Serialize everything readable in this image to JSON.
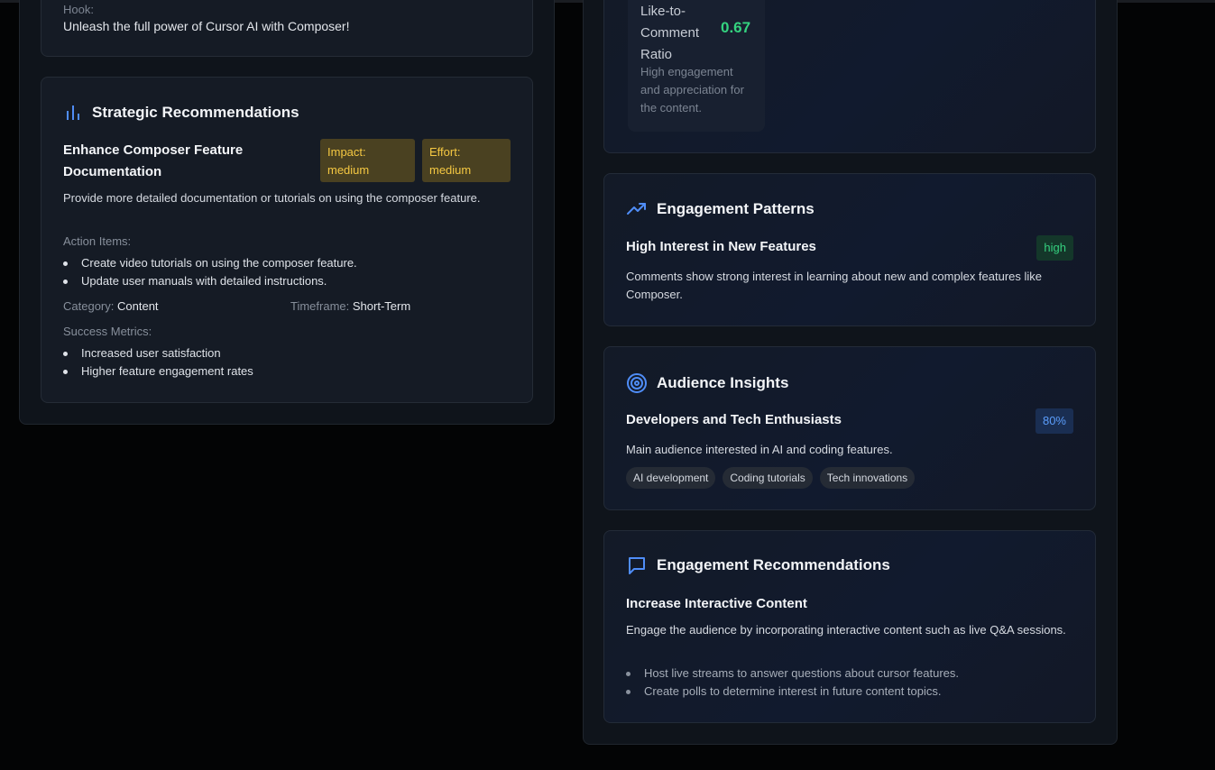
{
  "hook": {
    "label": "Hook:",
    "text": "Unleash the full power of Cursor AI with Composer!"
  },
  "strategic": {
    "title": "Strategic Recommendations",
    "rec_title": "Enhance Composer Feature Documentation",
    "impact": "Impact: medium",
    "effort": "Effort: medium",
    "description": "Provide more detailed documentation or tutorials on using the composer feature.",
    "action_items_label": "Action Items:",
    "action_items": [
      "Create video tutorials on using the composer feature.",
      "Update user manuals with detailed instructions."
    ],
    "category_label": "Category:",
    "category": "Content",
    "timeframe_label": "Timeframe:",
    "timeframe": "Short-Term",
    "success_label": "Success Metrics:",
    "success_metrics": [
      "Increased user satisfaction",
      "Higher feature engagement rates"
    ]
  },
  "metric": {
    "label": "Like-to-Comment Ratio",
    "value": "0.67",
    "description": "High engagement and appreciation for the content."
  },
  "patterns": {
    "title": "Engagement Patterns",
    "item_title": "High Interest in New Features",
    "level": "high",
    "description": "Comments show strong interest in learning about new and complex features like Composer."
  },
  "audience": {
    "title": "Audience Insights",
    "item_title": "Developers and Tech Enthusiasts",
    "percent": "80%",
    "description": "Main audience interested in AI and coding features.",
    "tags": [
      "AI development",
      "Coding tutorials",
      "Tech innovations"
    ]
  },
  "engagement_recs": {
    "title": "Engagement Recommendations",
    "item_title": "Increase Interactive Content",
    "description": "Engage the audience by incorporating interactive content such as live Q&A sessions.",
    "items": [
      "Host live streams to answer questions about cursor features.",
      "Create polls to determine interest in future content topics."
    ]
  },
  "colors": {
    "accent_blue": "#4f8df7",
    "success_green": "#34d37f",
    "warning_yellow": "#f5c842"
  }
}
